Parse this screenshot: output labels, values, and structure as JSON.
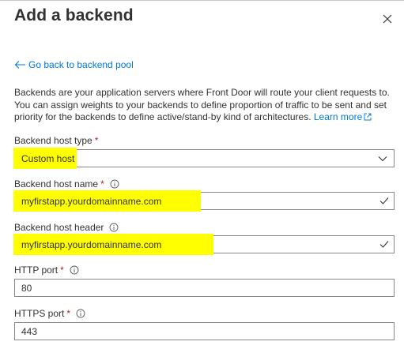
{
  "panel": {
    "title": "Add a backend",
    "back_link": "Go back to backend pool",
    "description": "Backends are your application servers where Front Door will route your client requests to. You can assign weights to your backends to define proportion of traffic to be sent and set priority for the backends to define active/stand-by kind of architectures.",
    "learn_more": "Learn more"
  },
  "form": {
    "host_type": {
      "label": "Backend host type",
      "required_mark": "*",
      "value": "Custom host"
    },
    "host_name": {
      "label": "Backend host name",
      "required_mark": "*",
      "value": "myfirstapp.yourdomainname.com"
    },
    "host_header": {
      "label": "Backend host header",
      "value": "myfirstapp.yourdomainname.com"
    },
    "http_port": {
      "label": "HTTP port",
      "required_mark": "*",
      "value": "80"
    },
    "https_port": {
      "label": "HTTPS port",
      "required_mark": "*",
      "value": "443"
    }
  },
  "colors": {
    "link": "#0078d4",
    "required": "#a4262c",
    "highlight": "#ffff00",
    "border": "#8a8886"
  }
}
